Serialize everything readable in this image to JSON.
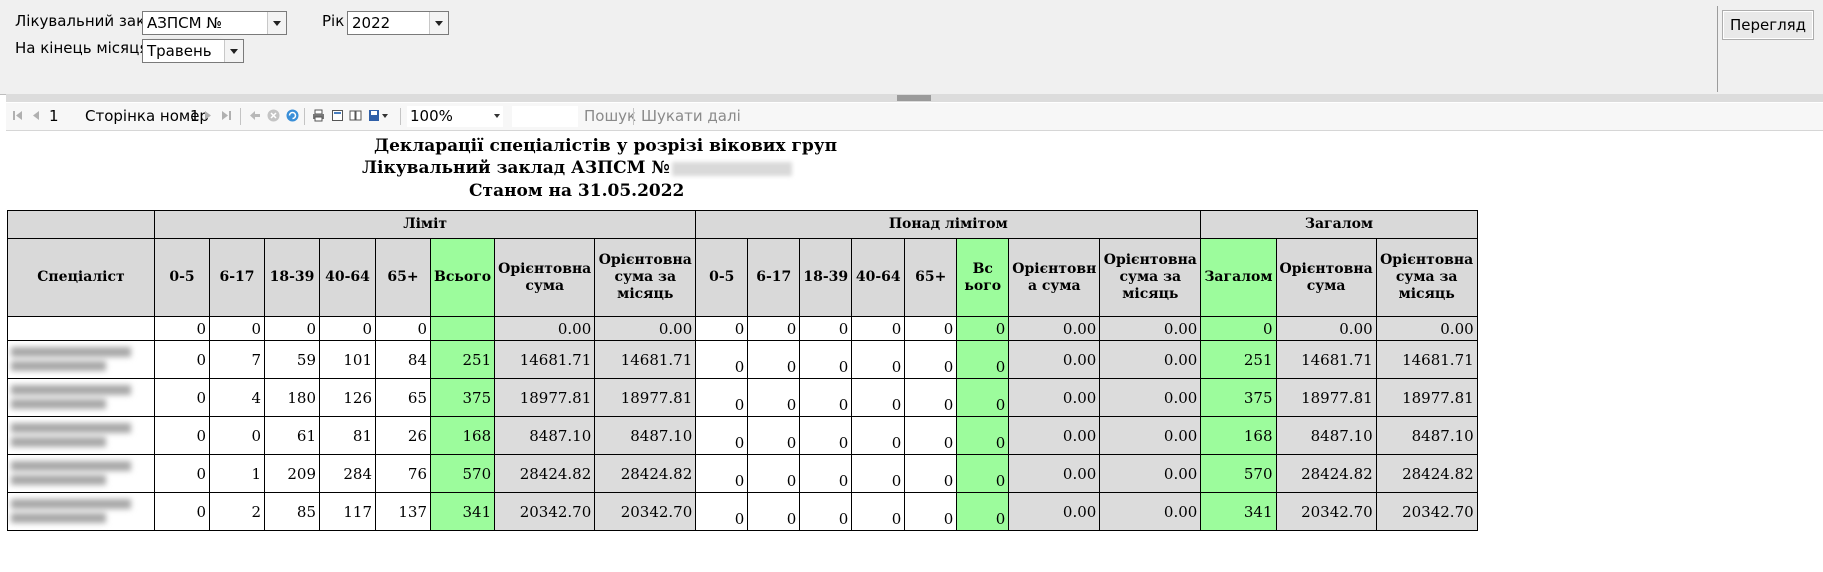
{
  "filters": {
    "facility_label": "Лікувальний заклад",
    "facility_value": "АЗПСМ №",
    "year_label": "Рік",
    "year_value": "2022",
    "month_label": "На кінець місяця",
    "month_value": "Травень",
    "view_button": "Перегляд"
  },
  "toolbar": {
    "page_current": "1",
    "page_label": "Сторінка номер",
    "page_total": "1",
    "zoom": "100%",
    "search": "Пошук",
    "search_next": "Шукати далі"
  },
  "report": {
    "title": "Декларації спеціалістів у розрізі вікових груп",
    "facility_line": "Лікувальний заклад  АЗПСМ №",
    "date_line": "Станом на 31.05.2022",
    "group_headers": [
      "Ліміт",
      "Понад лімітом",
      "Загалом"
    ],
    "specialist_header": "Спеціаліст",
    "limit_cols": [
      "0-5",
      "6-17",
      "18-39",
      "40-64",
      "65+",
      "Всього",
      "Орієнтовна сума",
      "Орієнтовна сума за місяць"
    ],
    "over_cols": [
      "0-5",
      "6-17",
      "18-39",
      "40-64",
      "65+",
      "Вс ього",
      "Орієнтовн а сума",
      "Орієнтовна сума за місяць"
    ],
    "total_cols": [
      "Загалом",
      "Орієнтовна сума",
      "Орієнтовна сума за місяць"
    ],
    "rows": [
      {
        "limit": [
          "0",
          "0",
          "0",
          "0",
          "0",
          "",
          "0.00",
          "0.00"
        ],
        "over": [
          "0",
          "0",
          "0",
          "0",
          "0",
          "0",
          "0.00",
          "0.00"
        ],
        "total": [
          "0",
          "0.00",
          "0.00"
        ]
      },
      {
        "limit": [
          "0",
          "7",
          "59",
          "101",
          "84",
          "251",
          "14681.71",
          "14681.71"
        ],
        "over": [
          "0",
          "0",
          "0",
          "0",
          "0",
          "0",
          "0.00",
          "0.00"
        ],
        "total": [
          "251",
          "14681.71",
          "14681.71"
        ]
      },
      {
        "limit": [
          "0",
          "4",
          "180",
          "126",
          "65",
          "375",
          "18977.81",
          "18977.81"
        ],
        "over": [
          "0",
          "0",
          "0",
          "0",
          "0",
          "0",
          "0.00",
          "0.00"
        ],
        "total": [
          "375",
          "18977.81",
          "18977.81"
        ]
      },
      {
        "limit": [
          "0",
          "0",
          "61",
          "81",
          "26",
          "168",
          "8487.10",
          "8487.10"
        ],
        "over": [
          "0",
          "0",
          "0",
          "0",
          "0",
          "0",
          "0.00",
          "0.00"
        ],
        "total": [
          "168",
          "8487.10",
          "8487.10"
        ]
      },
      {
        "limit": [
          "0",
          "1",
          "209",
          "284",
          "76",
          "570",
          "28424.82",
          "28424.82"
        ],
        "over": [
          "0",
          "0",
          "0",
          "0",
          "0",
          "0",
          "0.00",
          "0.00"
        ],
        "total": [
          "570",
          "28424.82",
          "28424.82"
        ]
      },
      {
        "limit": [
          "0",
          "2",
          "85",
          "117",
          "137",
          "341",
          "20342.70",
          "20342.70"
        ],
        "over": [
          "0",
          "0",
          "0",
          "0",
          "0",
          "0",
          "0.00",
          "0.00"
        ],
        "total": [
          "341",
          "20342.70",
          "20342.70"
        ]
      }
    ]
  }
}
